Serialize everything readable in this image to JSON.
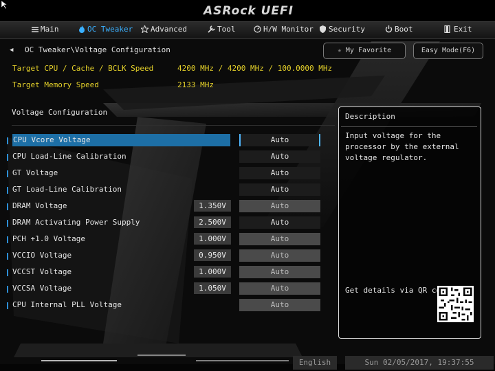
{
  "header": {
    "logo": "ASRock UEFI"
  },
  "nav": [
    {
      "label": "Main",
      "icon": "list-icon",
      "active": false
    },
    {
      "label": "OC Tweaker",
      "icon": "flame-icon",
      "active": true
    },
    {
      "label": "Advanced",
      "icon": "star-icon",
      "active": false
    },
    {
      "label": "Tool",
      "icon": "tool-icon",
      "active": false
    },
    {
      "label": "H/W Monitor",
      "icon": "monitor-icon",
      "active": false
    },
    {
      "label": "Security",
      "icon": "shield-icon",
      "active": false
    },
    {
      "label": "Boot",
      "icon": "power-icon",
      "active": false
    },
    {
      "label": "Exit",
      "icon": "exit-icon",
      "active": false
    }
  ],
  "breadcrumb": "OC Tweaker\\Voltage Configuration",
  "buttons": {
    "my_favorite": "My Favorite",
    "easy_mode": "Easy Mode(F6)"
  },
  "info": [
    {
      "label": "Target CPU / Cache / BCLK Speed",
      "value": "4200 MHz / 4200 MHz / 100.0000 MHz"
    },
    {
      "label": "Target Memory Speed",
      "value": "2133 MHz"
    }
  ],
  "section_title": "Voltage Configuration",
  "settings": [
    {
      "label": "CPU Vcore Voltage",
      "current": "",
      "value": "Auto"
    },
    {
      "label": "CPU Load-Line Calibration",
      "current": "",
      "value": "Auto"
    },
    {
      "label": "GT Voltage",
      "current": "",
      "value": "Auto"
    },
    {
      "label": "GT Load-Line Calibration",
      "current": "",
      "value": "Auto"
    },
    {
      "label": "DRAM Voltage",
      "current": "1.350V",
      "value": "Auto"
    },
    {
      "label": "DRAM Activating Power Supply",
      "current": "2.500V",
      "value": "Auto"
    },
    {
      "label": "PCH +1.0 Voltage",
      "current": "1.000V",
      "value": "Auto"
    },
    {
      "label": "VCCIO Voltage",
      "current": "0.950V",
      "value": "Auto"
    },
    {
      "label": "VCCST Voltage",
      "current": "1.000V",
      "value": "Auto"
    },
    {
      "label": "VCCSA Voltage",
      "current": "1.050V",
      "value": "Auto"
    },
    {
      "label": "CPU Internal PLL Voltage",
      "current": "",
      "value": "Auto"
    }
  ],
  "description": {
    "title": "Description",
    "text": "Input voltage for the processor by the external voltage regulator.",
    "qr_label": "Get details via QR code"
  },
  "footer": {
    "language": "English",
    "datetime": "Sun 02/05/2017, 19:37:55"
  },
  "colors": {
    "accent": "#3ab0ff",
    "highlight": "#1d6fa6",
    "info_text": "#e6d22a"
  }
}
